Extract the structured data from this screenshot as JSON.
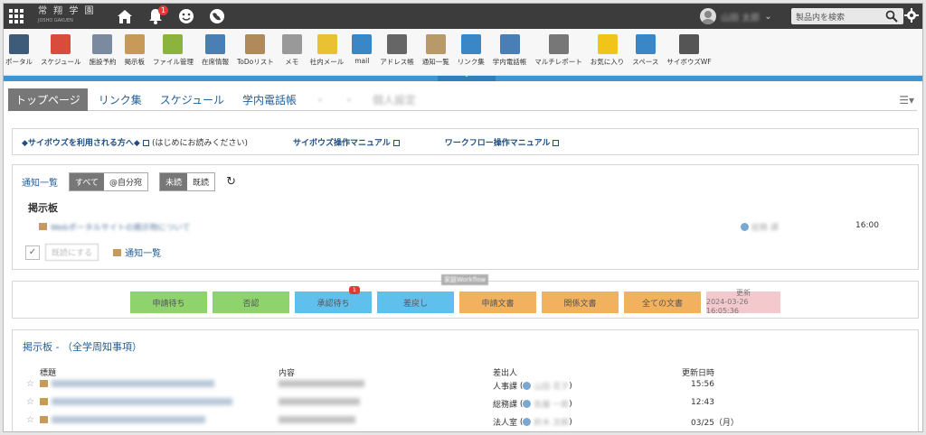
{
  "topbar": {
    "logo": "常 翔 学 園",
    "logo_sub": "JOSHO GAKUEN",
    "notification_count": "1",
    "user_name": "山田 太郎",
    "search_placeholder": "製品内を検索"
  },
  "launcher": [
    {
      "label": "ポータル",
      "icon": "portal-icon",
      "color": "#3e5b7a"
    },
    {
      "label": "スケジュール",
      "icon": "calendar-icon",
      "color": "#d94c3d"
    },
    {
      "label": "施設予約",
      "icon": "facility-icon",
      "color": "#7a8aa0"
    },
    {
      "label": "掲示板",
      "icon": "bulletin-icon",
      "color": "#c89a5a"
    },
    {
      "label": "ファイル管理",
      "icon": "file-icon",
      "color": "#8db33f"
    },
    {
      "label": "在席情報",
      "icon": "presence-icon",
      "color": "#4a7fb5"
    },
    {
      "label": "ToDoリスト",
      "icon": "todo-icon",
      "color": "#b08a5a"
    },
    {
      "label": "メモ",
      "icon": "memo-icon",
      "color": "#999999"
    },
    {
      "label": "社内メール",
      "icon": "mail-bubble-icon",
      "color": "#e8c232"
    },
    {
      "label": "mail",
      "icon": "mail-icon",
      "color": "#3a87c8"
    },
    {
      "label": "アドレス帳",
      "icon": "address-icon",
      "color": "#666666"
    },
    {
      "label": "通知一覧",
      "icon": "inbox-icon",
      "color": "#b89a6a"
    },
    {
      "label": "リンク集",
      "icon": "globe-icon",
      "color": "#3a87c8"
    },
    {
      "label": "学内電話帳",
      "icon": "phone-icon",
      "color": "#4a7fb5"
    },
    {
      "label": "マルチレポート",
      "icon": "report-icon",
      "color": "#777777"
    },
    {
      "label": "お気に入り",
      "icon": "star-icon",
      "color": "#f0c419"
    },
    {
      "label": "スペース",
      "icon": "space-icon",
      "color": "#3a87c8"
    },
    {
      "label": "サイボウズWF",
      "icon": "stamp-icon",
      "color": "#555555"
    }
  ],
  "tabs": [
    "トップページ",
    "リンク集",
    "スケジュール",
    "学内電話帳",
    "・",
    "・",
    "個人設定"
  ],
  "links": {
    "l1": "◆サイボウズを利用される方へ◆",
    "l1_note": "(はじめにお読みください)",
    "l2": "サイボウズ操作マニュアル",
    "l3": "ワークフロー操作マニュアル"
  },
  "notice": {
    "title": "通知一覧",
    "filter_all": "すべて",
    "filter_self": "@自分宛",
    "filter_unread": "未読",
    "filter_read": "既読",
    "reload_icon": "↻",
    "board_label": "掲示板",
    "item_text": "Webポータルサイトの掲示物について",
    "item_sender": "総務 課",
    "item_time": "16:00",
    "mark_read": "既読にする",
    "link": "通知一覧"
  },
  "workflow": {
    "title": "家庭Workflow",
    "buttons": [
      {
        "label": "申請待ち",
        "color": "#8ed36b"
      },
      {
        "label": "否認",
        "color": "#8ed36b"
      },
      {
        "label": "承認待ち",
        "color": "#5fc0ee",
        "badge": "1"
      },
      {
        "label": "差戻し",
        "color": "#5fc0ee"
      },
      {
        "label": "申請文書",
        "color": "#f2b15e"
      },
      {
        "label": "関係文書",
        "color": "#f2b15e"
      },
      {
        "label": "全ての文書",
        "color": "#f2b15e"
      }
    ],
    "update_label": "更新",
    "update_time": "2024-03-26 16:05:36"
  },
  "bulletin": {
    "title": "掲示板 - （全学周知事項）",
    "headers": {
      "title": "標題",
      "content": "内容",
      "sender": "差出人",
      "date": "更新日時"
    },
    "rows": [
      {
        "sender_dept": "人事課",
        "sender_name": "山田 花子",
        "date": "15:56"
      },
      {
        "sender_dept": "総務課",
        "sender_name": "佐藤 一郎",
        "date": "12:43"
      },
      {
        "sender_dept": "法人室",
        "sender_name": "鈴木 次郎",
        "date": "03/25（月）"
      }
    ]
  }
}
